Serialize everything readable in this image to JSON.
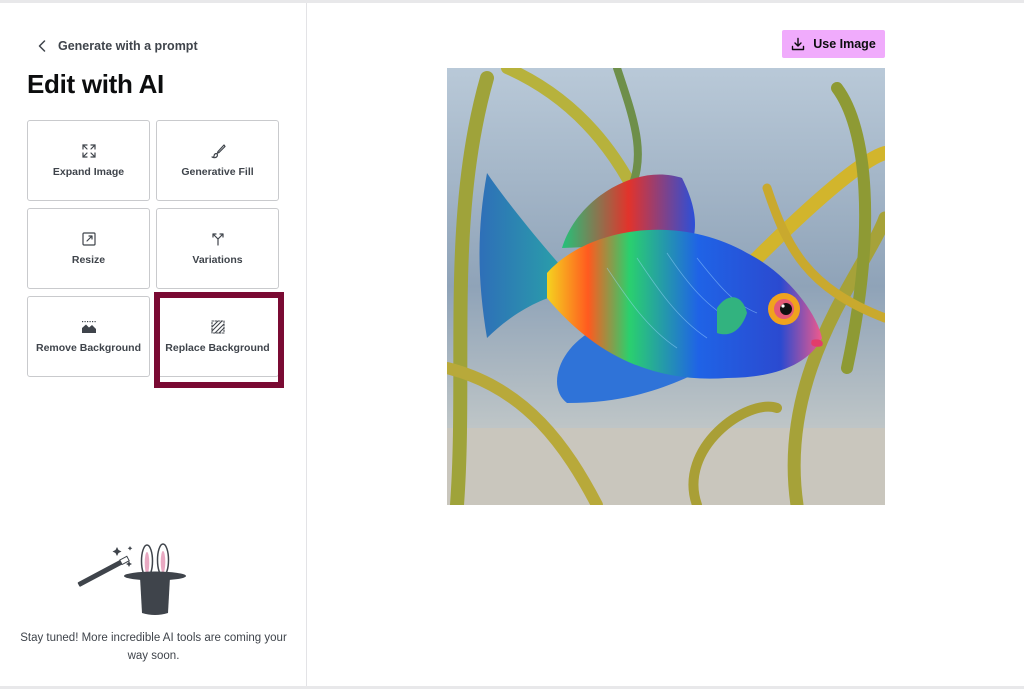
{
  "sidebar": {
    "back_label": "Generate with a prompt",
    "title": "Edit with AI",
    "tools": [
      {
        "label": "Expand Image",
        "icon": "expand-icon"
      },
      {
        "label": "Generative Fill",
        "icon": "brush-icon"
      },
      {
        "label": "Resize",
        "icon": "resize-icon"
      },
      {
        "label": "Variations",
        "icon": "variations-icon"
      },
      {
        "label": "Remove Background",
        "icon": "remove-background-icon"
      },
      {
        "label": "Replace Background",
        "icon": "replace-background-icon"
      }
    ],
    "highlighted_tool": "Replace Background",
    "promo": {
      "icon": "magic-hat-icon",
      "text": "Stay tuned! More incredible AI tools are coming your way soon."
    }
  },
  "main": {
    "use_image_label": "Use Image",
    "image": {
      "subject": "colorful tropical fish among seaweed",
      "icon": "fish-image"
    }
  },
  "colors": {
    "accent": "#f0abfc",
    "highlight_border": "#7a0a33",
    "text": "#0c0d0e",
    "muted_text": "#3f444b",
    "border": "#c9cacd"
  }
}
